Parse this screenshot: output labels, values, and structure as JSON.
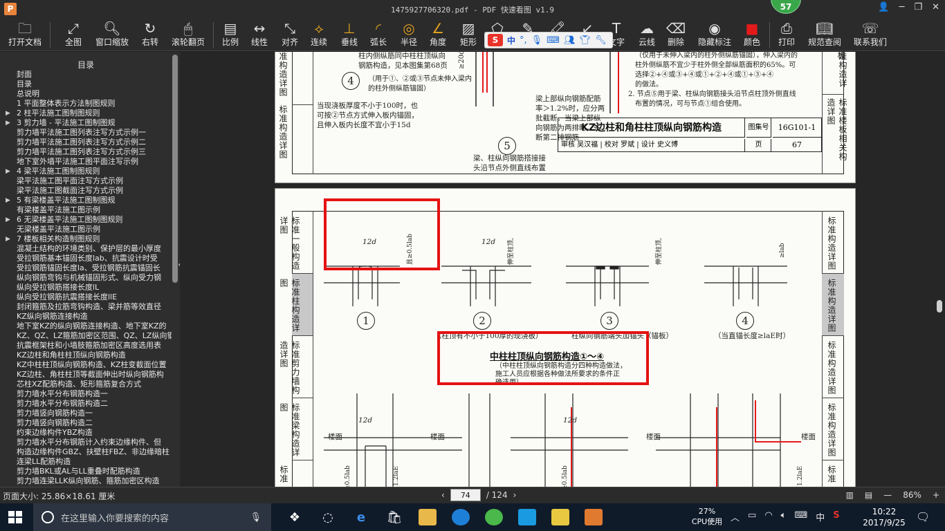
{
  "titlebar": {
    "logo": "P",
    "title": "1475927706320.pdf - PDF 快速看图 v1.9",
    "badge": "57"
  },
  "toolbar": {
    "items": [
      {
        "label": "打开文档",
        "icon": "folder-icon"
      },
      {
        "label": "全图",
        "icon": "fit-all-icon"
      },
      {
        "label": "窗口缩放",
        "icon": "zoom-window-icon"
      },
      {
        "label": "右转",
        "icon": "rotate-right-icon"
      },
      {
        "label": "滚轮翻页",
        "icon": "mouse-wheel-icon"
      },
      {
        "label": "比例",
        "icon": "scale-icon"
      },
      {
        "label": "线性",
        "icon": "linear-measure-icon"
      },
      {
        "label": "对齐",
        "icon": "align-measure-icon"
      },
      {
        "label": "连续",
        "icon": "continuous-measure-icon"
      },
      {
        "label": "垂线",
        "icon": "perpendicular-icon"
      },
      {
        "label": "弧长",
        "icon": "arc-length-icon"
      },
      {
        "label": "半径",
        "icon": "radius-icon"
      },
      {
        "label": "角度",
        "icon": "angle-icon"
      },
      {
        "label": "矩形",
        "icon": "rectangle-area-icon"
      },
      {
        "label": "异形",
        "icon": "polygon-area-icon"
      },
      {
        "label": "画笔",
        "icon": "pen-icon"
      },
      {
        "label": "高亮",
        "icon": "highlight-icon"
      },
      {
        "label": "箭头",
        "icon": "arrow-icon"
      },
      {
        "label": "文字",
        "icon": "text-icon"
      },
      {
        "label": "云线",
        "icon": "cloud-line-icon"
      },
      {
        "label": "删除",
        "icon": "eraser-icon"
      },
      {
        "label": "隐藏标注",
        "icon": "hide-annotation-icon"
      },
      {
        "label": "颜色",
        "icon": "color-icon"
      },
      {
        "label": "打印",
        "icon": "print-icon"
      },
      {
        "label": "规范查阅",
        "icon": "standards-book-icon"
      },
      {
        "label": "联系我们",
        "icon": "contact-icon"
      }
    ],
    "ime": {
      "logo": "S",
      "lang": "中",
      "dot": "°,"
    }
  },
  "sidebar": {
    "title": "目录",
    "items": [
      {
        "label": "封面",
        "arrow": ""
      },
      {
        "label": "目录",
        "arrow": ""
      },
      {
        "label": "总说明",
        "arrow": ""
      },
      {
        "label": "1 平面整体表示方法制图规则",
        "arrow": ""
      },
      {
        "label": "2 柱平法施工图制图规则",
        "arrow": "▶"
      },
      {
        "label": "3 剪力墙 - 平法施工图制图规",
        "arrow": "▶"
      },
      {
        "label": "剪力墙平法施工图列表注写方式示例一",
        "arrow": ""
      },
      {
        "label": "剪力墙平法施工图列表注写方式示例二",
        "arrow": ""
      },
      {
        "label": "剪力墙平法施工图列表注写方式示例三",
        "arrow": ""
      },
      {
        "label": "地下室外墙平法施工图平面注写示例",
        "arrow": ""
      },
      {
        "label": "4 梁平法施工图制图规则",
        "arrow": "▶"
      },
      {
        "label": "梁平法施工图平面注写方式示例",
        "arrow": ""
      },
      {
        "label": "梁平法施工图截面注写方式示例",
        "arrow": ""
      },
      {
        "label": "5 有梁楼盖平法施工图制图规",
        "arrow": "▶"
      },
      {
        "label": "有梁楼盖平法施工图示例",
        "arrow": ""
      },
      {
        "label": "6 无梁楼盖平法施工图制图规则",
        "arrow": "▶"
      },
      {
        "label": "无梁楼盖平法施工图示例",
        "arrow": ""
      },
      {
        "label": "7 楼板相关构造制图规则",
        "arrow": "▶"
      },
      {
        "label": "混凝土结构的环境类别、保护层的最小厚度",
        "arrow": ""
      },
      {
        "label": "受拉钢筋基本锚固长度lab、抗震设计时受",
        "arrow": ""
      },
      {
        "label": "受拉钢筋锚固长度la、受拉钢筋抗震锚固长",
        "arrow": ""
      },
      {
        "label": "纵向钢筋弯钩与机械锚固形式、纵向受力钢",
        "arrow": ""
      },
      {
        "label": "纵向受拉钢筋搭接长度lL",
        "arrow": ""
      },
      {
        "label": "纵向受拉钢筋抗震搭接长度llE",
        "arrow": ""
      },
      {
        "label": "封闭箍筋及拉筋弯钩构造、梁并筋等效直径",
        "arrow": ""
      },
      {
        "label": "KZ纵向钢筋连接构造",
        "arrow": ""
      },
      {
        "label": "地下室KZ的纵向钢筋连接构造、地下室KZ的",
        "arrow": ""
      },
      {
        "label": "KZ、QZ、LZ箍筋加密区范围、QZ、LZ纵向钢",
        "arrow": ""
      },
      {
        "label": "抗震框架柱和小墙肢箍筋加密区高度选用表",
        "arrow": ""
      },
      {
        "label": "KZ边柱和角柱柱顶纵向钢筋构造",
        "arrow": ""
      },
      {
        "label": "KZ中柱柱顶纵向钢筋构造、KZ柱变截面位置",
        "arrow": ""
      },
      {
        "label": "KZ边柱、角柱柱顶等截面伸出时纵向钢筋构",
        "arrow": ""
      },
      {
        "label": "芯柱XZ配筋构造、矩形箍筋复合方式",
        "arrow": ""
      },
      {
        "label": "剪力墙水平分布钢筋构造一",
        "arrow": ""
      },
      {
        "label": "剪力墙水平分布钢筋构造二",
        "arrow": ""
      },
      {
        "label": "剪力墙竖向钢筋构造一",
        "arrow": ""
      },
      {
        "label": "剪力墙竖向钢筋构造二",
        "arrow": ""
      },
      {
        "label": "约束边缘构件YBZ构造",
        "arrow": ""
      },
      {
        "label": "剪力墙水平分布钢筋计入约束边缘构件、但",
        "arrow": ""
      },
      {
        "label": "构造边缘构件GBZ、扶壁柱FBZ、非边缘暗柱",
        "arrow": ""
      },
      {
        "label": "连梁LL配筋构造",
        "arrow": ""
      },
      {
        "label": "剪力墙BKL或AL与LL重叠时配筋构造",
        "arrow": ""
      },
      {
        "label": "剪力墙连梁LLK纵向钢筋、箍筋加密区构造",
        "arrow": ""
      }
    ]
  },
  "page1": {
    "left_labels": [
      "标准构造详图",
      "标准构造详图"
    ],
    "right_labels": [
      "标准构造详图",
      "板",
      "标准楼板相关构造详图"
    ],
    "note_a": "柱内侧纵筋同中柱柱顶纵向",
    "note_b": "钢筋构造，见本图集第68页",
    "node4_text": "（用于①、②或③节点未伸入梁内的柱外侧纵筋锚固）",
    "slab_text": "当现浇板厚度不小于100时，也可按②节点方式伸入板内锚固，且伸入板内长度不宜小于15d",
    "mid_text_a": "梁上部纵向钢筋配筋",
    "mid_text_b": "率＞1.2%时，应分两",
    "mid_text_c": "批截断。当梁上部纵",
    "mid_text_d": "向钢筋为两排时，先",
    "mid_text_e": "断第二排钢筋",
    "node5_text_a": "梁、柱纵向钢筋搭接接",
    "node5_text_b": "头沿节点外侧直线布置",
    "right_note_a": "（仅用于未伸入梁内的柱外侧纵筋锚固），伸入梁内的",
    "right_note_b": "柱外侧纵筋不宜少于柱外侧全部纵筋面积的65%。可",
    "right_note_c": "选择②+④或③+④或①+②+④或①+③+④",
    "right_note_d": "的做法。",
    "right_note_e": "2. 节点⑤用于梁、柱纵向钢筋接头沿节点柱顶外侧直线",
    "right_note_f": "布置的情况，可与节点①组合使用。",
    "title_block": "KZ边柱和角柱柱顶纵向钢筋构造",
    "atlas_label": "图集号",
    "atlas_no": "16G101-1",
    "page_label": "页",
    "page_no": "67",
    "review_row": "审核 吴汉福 | 校对 罗斌 | 设计 史义博",
    "circle4": "4",
    "circle5": "5"
  },
  "page2": {
    "left_labels": [
      "标准一般构造详图",
      "标准柱构造详图",
      "标准剪力墙构造详图",
      "标准梁构造详图",
      "标准"
    ],
    "right_labels": [
      "标准构造详图",
      "标准构造详图",
      "标准构造详图",
      "标准构造详图",
      "标准"
    ],
    "dim_12d": "12d",
    "dim_05lab": "且≥0.5lab",
    "dim_lab": "≥lab",
    "dim_top": "伸至柱顶,",
    "circles": [
      "1",
      "2",
      "3",
      "4"
    ],
    "caption_1": "（柱顶有不小于100厚的现浇板）",
    "caption_3": "柱纵向钢筋端头加锚头（锚板）",
    "caption_4": "（当直锚长度≥laE时）",
    "title": "中柱柱顶纵向钢筋构造①～④",
    "subtitle_a": "（中柱柱顶纵向钢筋构造分四种构造做法，",
    "subtitle_b": "施工人员应根据各种做法所要求的条件正",
    "subtitle_c": "确选用）",
    "floor_label": "楼面",
    "dim_05": "≥0.5lab",
    "dim_12": "1.2laE"
  },
  "statusbar": {
    "page_size": "页面大小: 25.86×18.61 厘米",
    "current_page": "74",
    "total_pages": "/ 124",
    "zoom": "86%",
    "zoom_minus": "—",
    "zoom_plus": "+"
  },
  "taskbar": {
    "search_placeholder": "在这里输入你要搜索的内容",
    "cpu_percent": "27%",
    "cpu_label": "CPU使用",
    "ime_lang": "中",
    "time": "10:22",
    "date": "2017/9/25"
  },
  "colors": {
    "toolbar_bg": "#2b2b2b",
    "annotation_red": "#e51212",
    "badge_green": "#3aa64a"
  }
}
